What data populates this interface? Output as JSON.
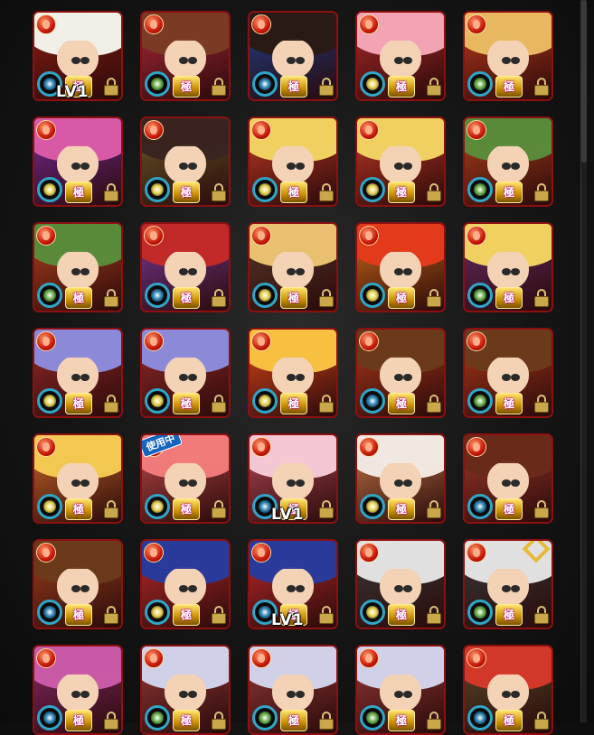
{
  "grid": {
    "label_level": "LV1",
    "label_in_use": "使用中",
    "label_rank": "極",
    "cards": [
      {
        "hair": "#f0efe8",
        "bg": "#8c1d12",
        "gauge": "#2f86b8",
        "level": true
      },
      {
        "hair": "#7a3a24",
        "bg": "#b0283a",
        "gauge": "#6ab04a"
      },
      {
        "hair": "#2a1a16",
        "bg": "#1c3f8a",
        "gauge": "#2f86b8"
      },
      {
        "hair": "#f2a3b4",
        "bg": "#b12a2a",
        "gauge": "#e8d250"
      },
      {
        "hair": "#e8b860",
        "bg": "#c23a1c",
        "gauge": "#6ab04a"
      },
      {
        "hair": "#d85aa6",
        "bg": "#7a2a9a",
        "gauge": "#e8d250"
      },
      {
        "hair": "#3a2420",
        "bg": "#6a5a2a",
        "gauge": "#e8d250"
      },
      {
        "hair": "#f0d060",
        "bg": "#c83a24",
        "gauge": "#e8d250"
      },
      {
        "hair": "#f0d060",
        "bg": "#c83a24",
        "gauge": "#e8d250"
      },
      {
        "hair": "#5a8a3a",
        "bg": "#b5421c",
        "gauge": "#6ab04a"
      },
      {
        "hair": "#5a8a3a",
        "bg": "#b5421c",
        "gauge": "#6ab04a"
      },
      {
        "hair": "#c22a2a",
        "bg": "#7a3a9a",
        "gauge": "#2f86b8"
      },
      {
        "hair": "#e8c070",
        "bg": "#5a3a2a",
        "gauge": "#e8d250"
      },
      {
        "hair": "#e23a1a",
        "bg": "#d06a1a",
        "gauge": "#e8d250"
      },
      {
        "hair": "#f0d060",
        "bg": "#6a2a6a",
        "gauge": "#6ab04a"
      },
      {
        "hair": "#8c8ad8",
        "bg": "#9a2a2a",
        "gauge": "#e8d250"
      },
      {
        "hair": "#8c8ad8",
        "bg": "#9a2a2a",
        "gauge": "#e8d250"
      },
      {
        "hair": "#f8c040",
        "bg": "#e2481a",
        "gauge": "#e8d250"
      },
      {
        "hair": "#6a3a1a",
        "bg": "#b23a1a",
        "gauge": "#2f86b8"
      },
      {
        "hair": "#6a3a1a",
        "bg": "#b23a1a",
        "gauge": "#6ab04a"
      },
      {
        "hair": "#f2c850",
        "bg": "#d06a2a",
        "gauge": "#e8d250"
      },
      {
        "hair": "#f07a7a",
        "bg": "#c04a4a",
        "gauge": "#e8d250",
        "in_use": true
      },
      {
        "hair": "#f3c7d3",
        "bg": "#b84a5a",
        "gauge": "#2f86b8",
        "level": true
      },
      {
        "hair": "#f0e8e0",
        "bg": "#c87a4a",
        "gauge": "#e8d250"
      },
      {
        "hair": "#6a2a1a",
        "bg": "#a23a2a",
        "gauge": "#2f86b8"
      },
      {
        "hair": "#6a3a1a",
        "bg": "#a0421c",
        "gauge": "#2f86b8"
      },
      {
        "hair": "#2a3a9a",
        "bg": "#c22a2a",
        "gauge": "#e8d250"
      },
      {
        "hair": "#2a3a9a",
        "bg": "#c22a2a",
        "gauge": "#2f86b8",
        "level": true
      },
      {
        "hair": "#e0e0e0",
        "bg": "#3a3a3a",
        "gauge": "#e8d250"
      },
      {
        "hair": "#e0e0e0",
        "bg": "#3a3a3a",
        "gauge": "#6ab04a",
        "link": true
      },
      {
        "hair": "#c85aa6",
        "bg": "#8a2a6a",
        "gauge": "#2f86b8"
      },
      {
        "hair": "#d0d0e8",
        "bg": "#9a3a3a",
        "gauge": "#6ab04a"
      },
      {
        "hair": "#d0d0e8",
        "bg": "#9a3a3a",
        "gauge": "#6ab04a"
      },
      {
        "hair": "#d0d0e8",
        "bg": "#9a3a3a",
        "gauge": "#6ab04a"
      },
      {
        "hair": "#d2382a",
        "bg": "#5a4a2a",
        "gauge": "#2f86b8"
      }
    ]
  }
}
